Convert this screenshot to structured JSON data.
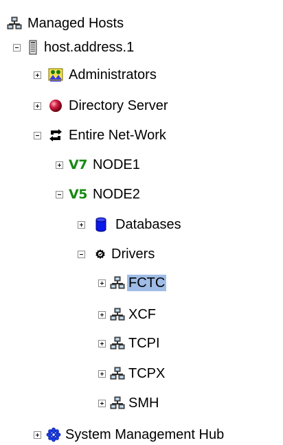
{
  "tree": {
    "root": {
      "label": "Managed Hosts",
      "icon": "network-hosts-icon"
    },
    "host": {
      "label": "host.address.1",
      "icon": "server-icon",
      "expanded": true
    },
    "administrators": {
      "label": "Administrators",
      "icon": "administrators-icon",
      "expanded": false
    },
    "directory_server": {
      "label": "Directory Server",
      "icon": "directory-server-icon",
      "expanded": false
    },
    "entire_network": {
      "label": "Entire Net-Work",
      "icon": "entire-network-icon",
      "expanded": true
    },
    "node1": {
      "badge": "V7",
      "label": "NODE1",
      "expanded": false
    },
    "node2": {
      "badge": "V5",
      "label": "NODE2",
      "expanded": true
    },
    "databases": {
      "label": "Databases",
      "icon": "database-icon",
      "expanded": false
    },
    "drivers": {
      "label": "Drivers",
      "icon": "drivers-icon",
      "expanded": true
    },
    "driver_items": [
      {
        "label": "FCTC",
        "icon": "network-hosts-icon",
        "selected": true
      },
      {
        "label": "XCF",
        "icon": "network-hosts-icon",
        "selected": false
      },
      {
        "label": "TCPI",
        "icon": "network-hosts-icon",
        "selected": false
      },
      {
        "label": "TCPX",
        "icon": "network-hosts-icon",
        "selected": false
      },
      {
        "label": "SMH",
        "icon": "network-hosts-icon",
        "selected": false
      }
    ],
    "system_management_hub": {
      "label": "System Management Hub",
      "icon": "system-management-hub-icon",
      "expanded": false
    }
  },
  "colors": {
    "selection": "#9fbce6",
    "version_badge": "#178a12",
    "database_blue": "#0a18e8",
    "hub_blue": "#1a3de0",
    "directory_red": "#c21a3a"
  }
}
